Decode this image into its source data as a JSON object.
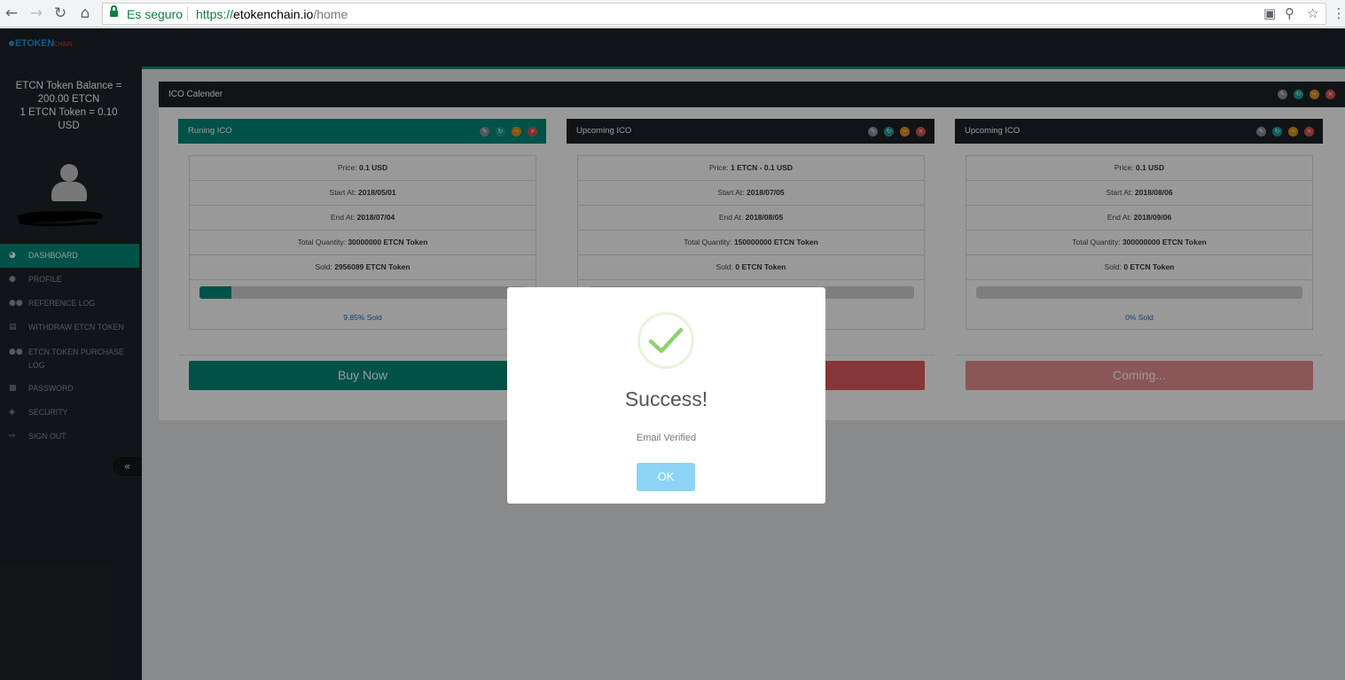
{
  "browser": {
    "back_icon": "arrow-left-icon",
    "forward_icon": "arrow-right-icon",
    "reload_icon": "reload-icon",
    "home_icon": "home-icon",
    "secure_label": "Es seguro",
    "url_scheme": "https://",
    "url_host": "etokenchain.io",
    "url_path": "/home",
    "translate_icon": "translate-icon",
    "zoom_icon": "zoom-icon",
    "bookmark_icon": "star-icon"
  },
  "header": {
    "logo_main": "ETOKEN",
    "logo_sub": "CHAIN"
  },
  "sidebar": {
    "balance_line1": "ETCN Token Balance =",
    "balance_line2": "200.00 ETCN",
    "balance_line3": "1 ETCN Token = 0.10",
    "balance_line4": "USD",
    "items": [
      {
        "label": "DASHBOARD",
        "icon": "dashboard-icon",
        "active": true
      },
      {
        "label": "PROFILE",
        "icon": "user-icon"
      },
      {
        "label": "REFERENCE LOG",
        "icon": "users-icon"
      },
      {
        "label": "WITHDRAW ETCN TOKEN",
        "icon": "credit-card-icon"
      },
      {
        "label": "ETCN TOKEN PURCHASE LOG",
        "icon": "users-icon"
      },
      {
        "label": "PASSWORD",
        "icon": "lock-icon"
      },
      {
        "label": "SECURITY",
        "icon": "shield-icon"
      },
      {
        "label": "SIGN OUT",
        "icon": "sign-out-icon"
      }
    ],
    "collapse_icon": "double-chevron-left-icon"
  },
  "panel": {
    "title": "ICO Calender",
    "columns": [
      {
        "title": "Runing ICO",
        "header_color": "#00897b",
        "price_label": "Price:",
        "price": "0.1 USD",
        "start_label": "Start At:",
        "start": "2018/05/01",
        "end_label": "End At:",
        "end": "2018/07/04",
        "qty_label": "Total Quantity:",
        "qty": "30000000 ETCN Token",
        "sold_label": "Sold:",
        "sold": "2956089 ETCN Token",
        "progress": 0.0985,
        "sold_pct": "9.85% Sold",
        "button": "Buy Now",
        "button_color": "#00897b"
      },
      {
        "title": "Upcoming ICO",
        "header_color": "#1d2227",
        "price_label": "Price:",
        "price": "1 ETCN - 0.1 USD",
        "start_label": "Start At:",
        "start": "2018/07/05",
        "end_label": "End At:",
        "end": "2018/08/05",
        "qty_label": "Total Quantity:",
        "qty": "150000000 ETCN Token",
        "sold_label": "Sold:",
        "sold": "0 ETCN Token",
        "progress": 0,
        "sold_pct": "",
        "button": "",
        "button_color": "#e05a5a"
      },
      {
        "title": "Upcoming ICO",
        "header_color": "#1d2227",
        "price_label": "Price:",
        "price": "0.1 USD",
        "start_label": "Start At:",
        "start": "2018/08/06",
        "end_label": "End At:",
        "end": "2018/09/06",
        "qty_label": "Total Quantity:",
        "qty": "300000000 ETCN Token",
        "sold_label": "Sold:",
        "sold": "0 ETCN Token",
        "progress": 0,
        "sold_pct": "0% Sold",
        "button": "Coming...",
        "button_color": "#e88f8f"
      }
    ]
  },
  "dialog": {
    "title": "Success!",
    "message": "Email Verified",
    "ok_label": "OK",
    "icon": "checkmark-icon"
  },
  "colors": {
    "accent": "#00897b",
    "dark": "#1d2227",
    "sidebar": "#1f2327",
    "ok_button": "#8cd4f5",
    "success": "#8ed16f"
  }
}
